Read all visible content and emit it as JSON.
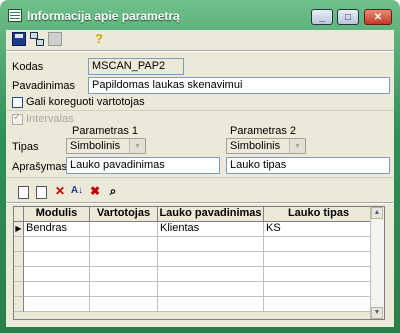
{
  "window": {
    "title": "Informacija apie parametrą"
  },
  "toolbar": {
    "help_glyph": "?"
  },
  "form": {
    "kodas_label": "Kodas",
    "kodas_value": "MSCAN_PAP2",
    "pavadinimas_label": "Pavadinimas",
    "pavadinimas_value": "Papildomas laukas skenavimui",
    "gali_koreguoti_label": "Gali koreguoti vartotojas",
    "intervalas_label": "Intervalas",
    "parametras1_label": "Parametras 1",
    "parametras2_label": "Parametras 2",
    "tipas_label": "Tipas",
    "tipas1_value": "Simbolinis",
    "tipas2_value": "Simbolinis",
    "aprasymas_label": "Aprašymas",
    "aprasymas1_value": "Lauko pavadinimas",
    "aprasymas2_value": "Lauko tipas"
  },
  "grid": {
    "columns": [
      "Modulis",
      "Vartotojas",
      "Lauko pavadinimas",
      "Lauko tipas"
    ],
    "rows": [
      {
        "modulis": "Bendras",
        "vartotojas": "",
        "lauko_pavadinimas": "Klientas",
        "lauko_tipas": "KS"
      }
    ]
  }
}
